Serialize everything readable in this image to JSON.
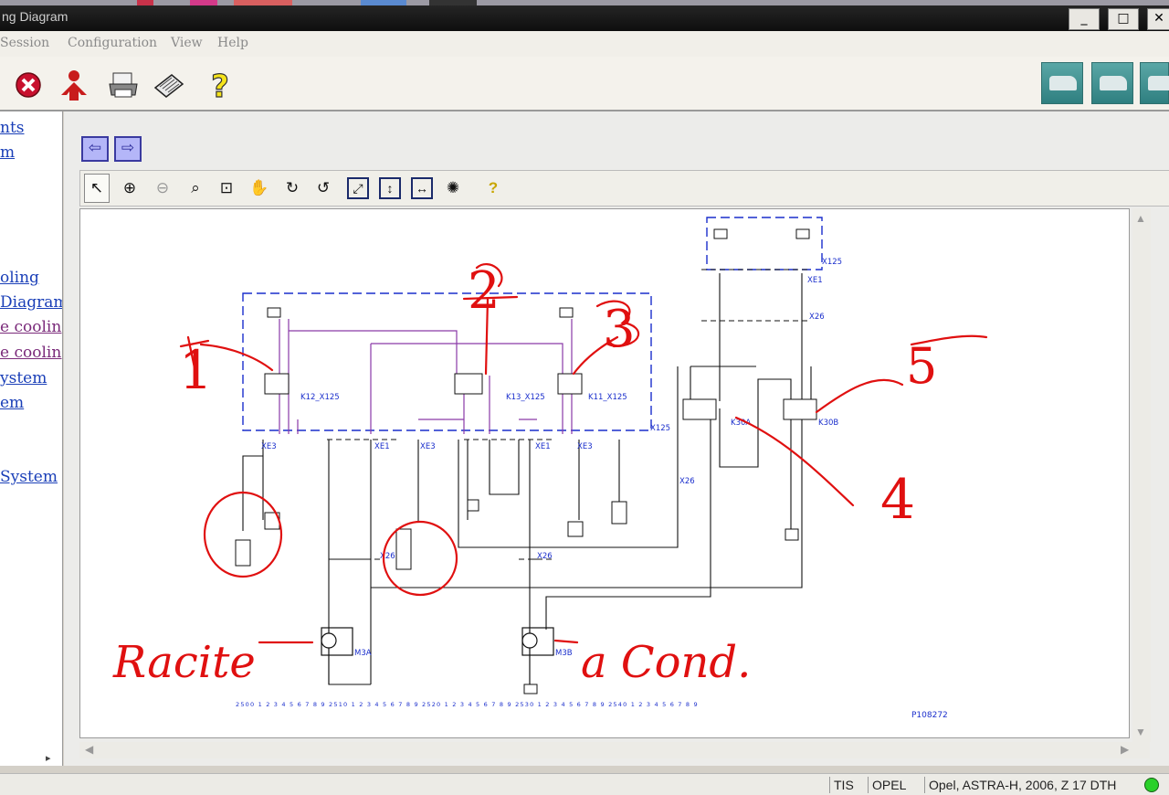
{
  "window": {
    "title": "ng Diagram",
    "min_label": "_",
    "max_label": "□",
    "close_label": "✕"
  },
  "menu": {
    "session": "Session",
    "configuration": "Configuration",
    "view": "View",
    "help": "Help"
  },
  "left_nav": [
    {
      "label": "nts"
    },
    {
      "label": "m"
    },
    {
      "label": "oling"
    },
    {
      "label": "Diagram"
    },
    {
      "label": "e cooling"
    },
    {
      "label": "e cooling"
    },
    {
      "label": "ystem"
    },
    {
      "label": "em"
    },
    {
      "label": "System"
    }
  ],
  "nav_buttons": {
    "back": "⇦",
    "forward": "⇨"
  },
  "diagram": {
    "labels": {
      "k12": "K12_X125",
      "k13": "K13_X125",
      "k11": "K11_X125",
      "x125_a": "X125",
      "x125_b": "X125",
      "k30a": "K30A",
      "k30b": "K30B",
      "xe1_top": "XE1",
      "x26_top": "X26",
      "xe3_a": "XE3",
      "xe1_a": "XE1",
      "xe3_b": "XE3",
      "xe1_b": "XE1",
      "xe3_c": "XE3",
      "x26_mid": "X26",
      "x26_l": "X26",
      "x26_c": "X26",
      "m3a": "M3A",
      "m3b": "M3B",
      "ref": "P108272",
      "scale": "2500 1 2 3 4 5 6 7 8 9 2510 1 2 3 4 5 6 7 8 9 2520 1 2 3 4 5 6 7 8 9 2530 1 2 3 4 5 6 7 8 9 2540 1 2 3 4 5 6 7 8 9"
    },
    "annotations": {
      "n1": "1",
      "n2": "2",
      "n3": "3",
      "n4": "4",
      "n5": "5",
      "left_word": "Racite",
      "right_word": "a Cond."
    }
  },
  "status": {
    "tis": "TIS",
    "brand": "OPEL",
    "vehicle": "Opel, ASTRA-H, 2006, Z 17 DTH"
  }
}
